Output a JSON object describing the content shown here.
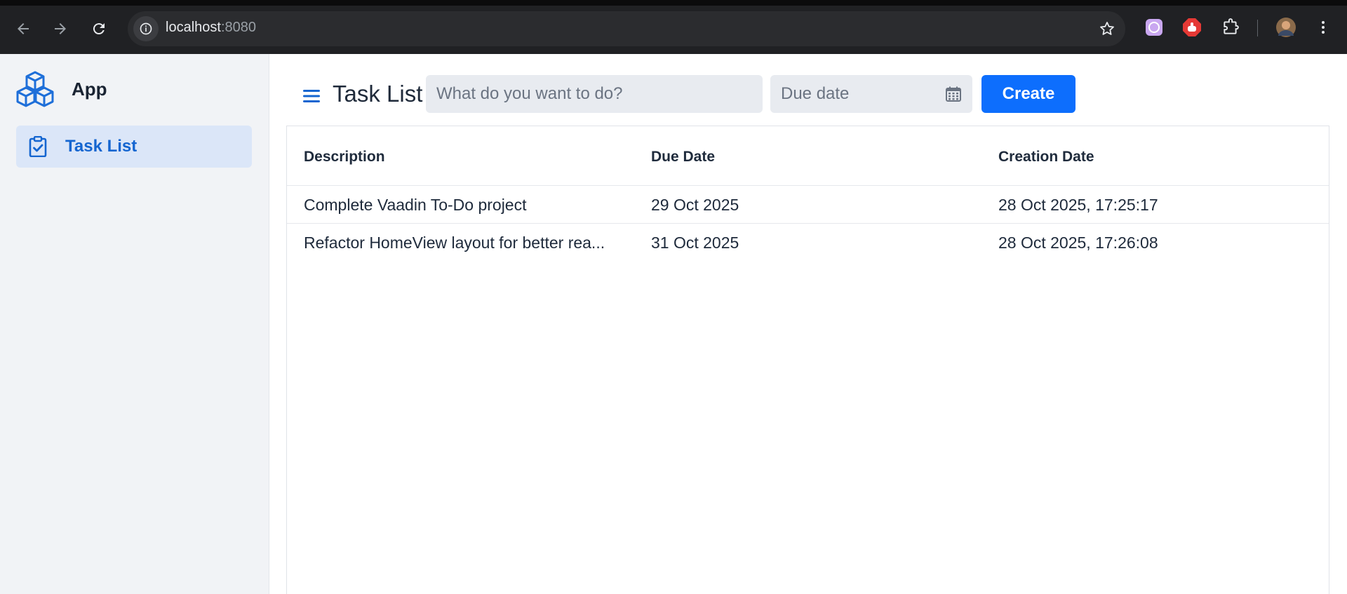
{
  "browser": {
    "url_host": "localhost",
    "url_port": ":8080"
  },
  "app": {
    "brand_name": "App",
    "nav": [
      {
        "label": "Task List",
        "icon": "clipboard-check-icon",
        "active": true
      }
    ]
  },
  "toolbar": {
    "title": "Task List",
    "description_placeholder": "What do you want to do?",
    "due_date_placeholder": "Due date",
    "create_label": "Create"
  },
  "grid": {
    "headers": [
      "Description",
      "Due Date",
      "Creation Date"
    ],
    "rows": [
      [
        "Complete Vaadin To-Do project",
        "29 Oct 2025",
        "28 Oct 2025, 17:25:17"
      ],
      [
        "Refactor HomeView layout for better rea...",
        "31 Oct 2025",
        "28 Oct 2025, 17:26:08"
      ]
    ]
  },
  "colors": {
    "accent": "#0d6efd",
    "nav_active_bg": "#dbe6f8",
    "drawer_bg": "#f1f3f6",
    "chrome_bg": "#202124"
  }
}
